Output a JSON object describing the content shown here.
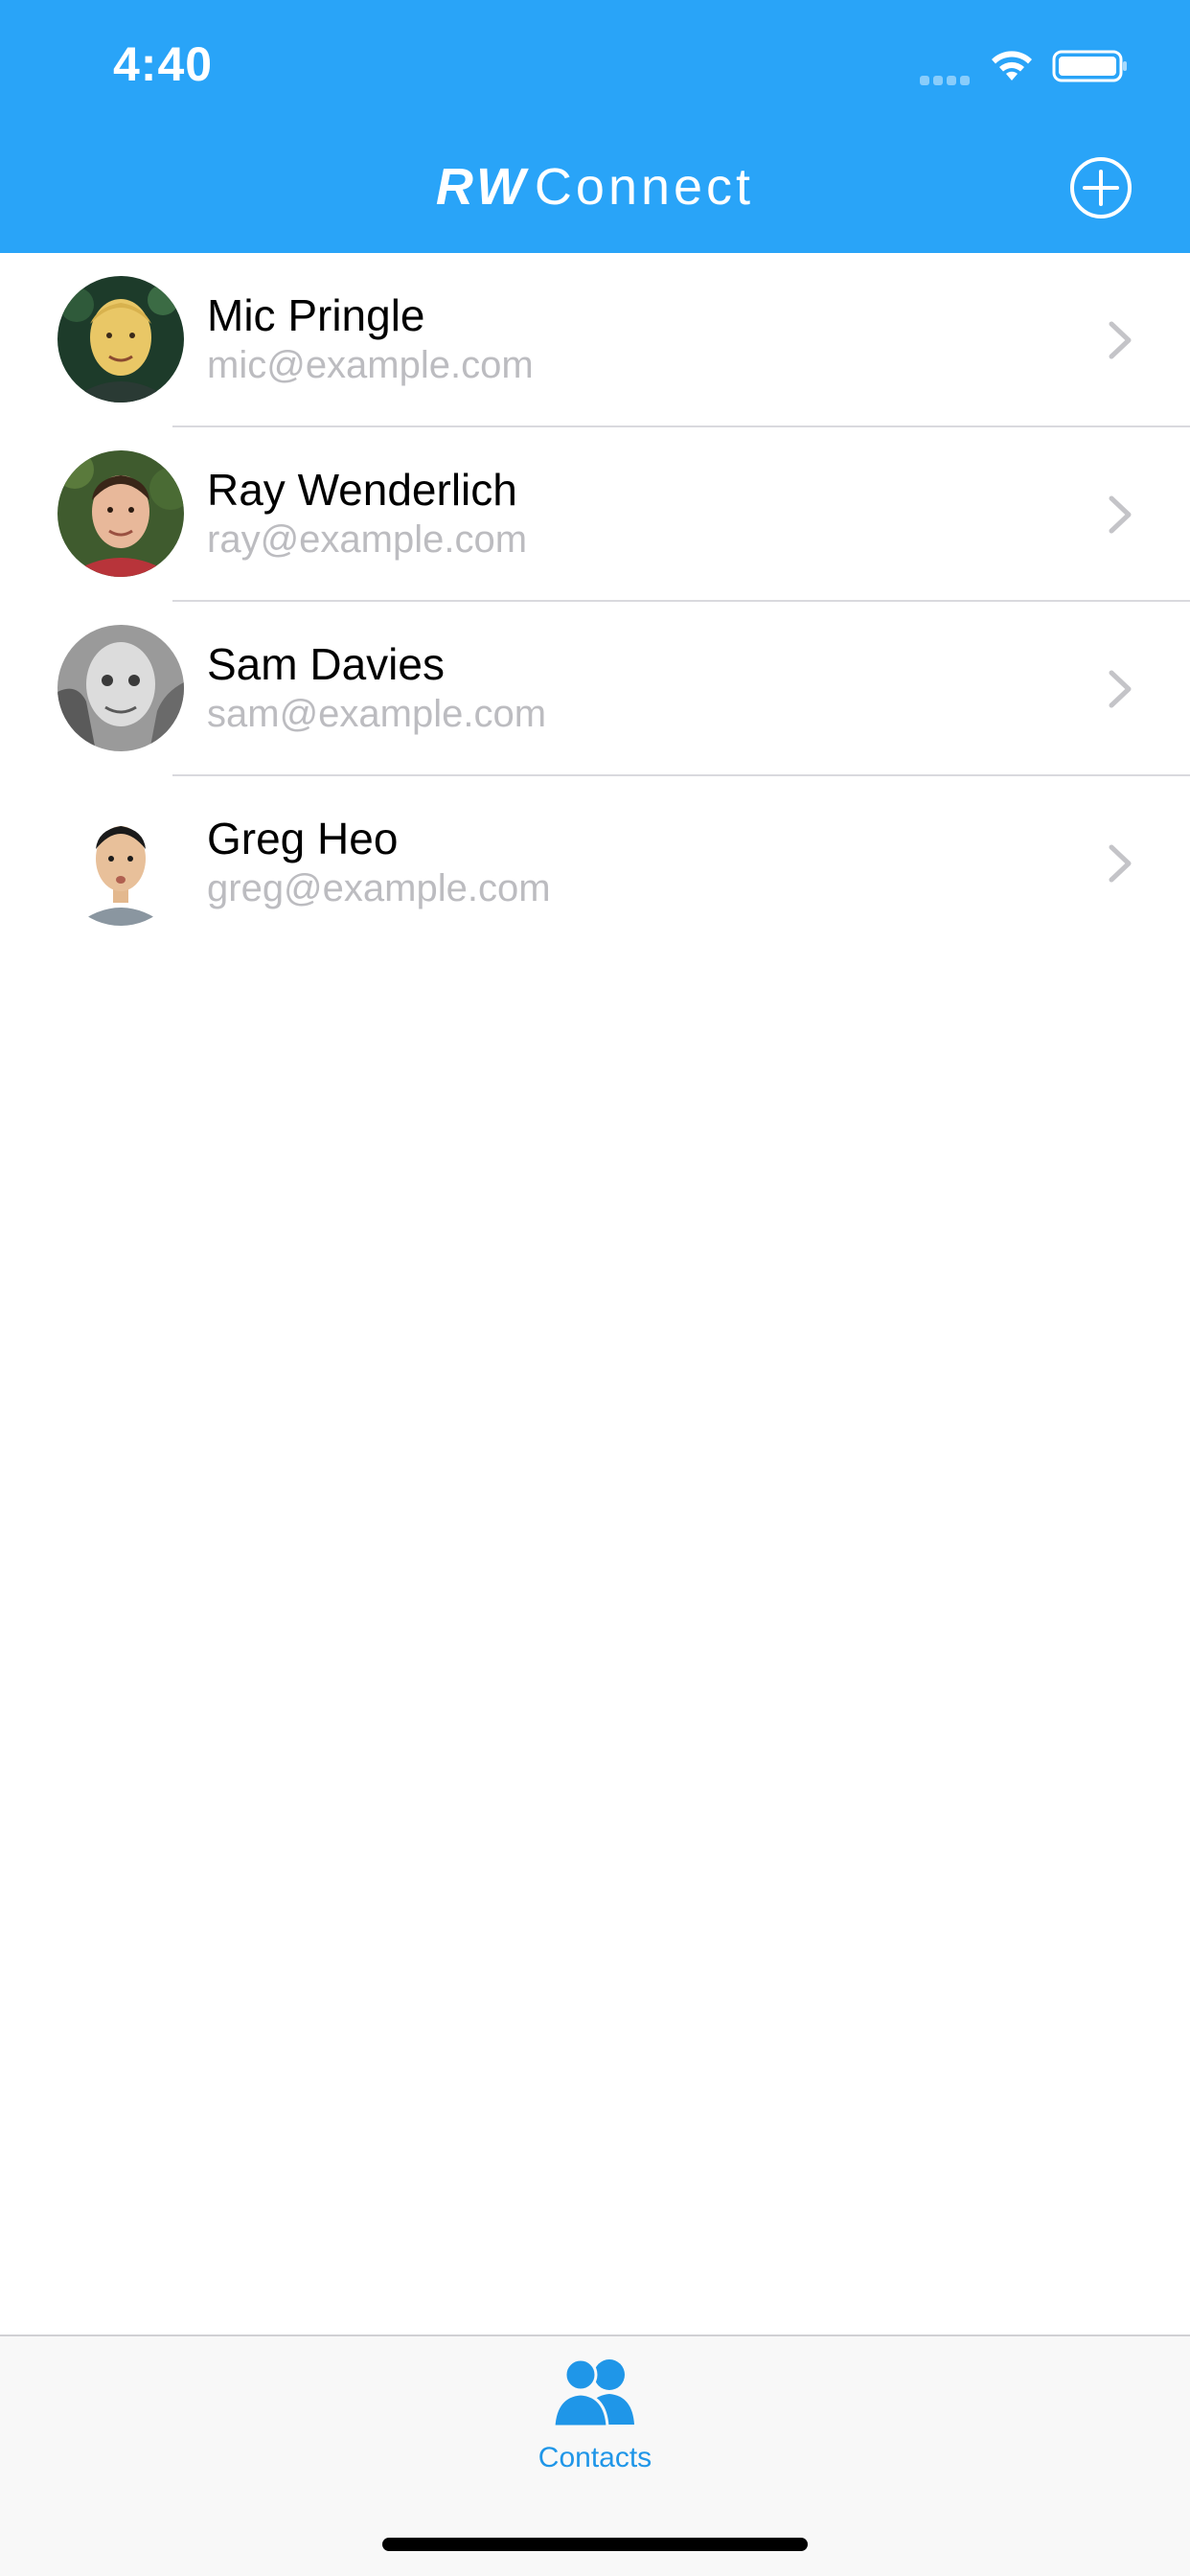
{
  "status_bar": {
    "time": "4:40"
  },
  "nav": {
    "title_bold": "RW",
    "title_light": "Connect",
    "accent_color": "#29a4f8",
    "add_icon": "plus-circle-icon"
  },
  "contacts": [
    {
      "name": "Mic Pringle",
      "email": "mic@example.com"
    },
    {
      "name": "Ray Wenderlich",
      "email": "ray@example.com"
    },
    {
      "name": "Sam Davies",
      "email": "sam@example.com"
    },
    {
      "name": "Greg Heo",
      "email": "greg@example.com"
    }
  ],
  "tab_bar": {
    "items": [
      {
        "label": "Contacts",
        "icon": "contacts-icon",
        "selected": true,
        "color": "#1f96e8"
      }
    ]
  }
}
